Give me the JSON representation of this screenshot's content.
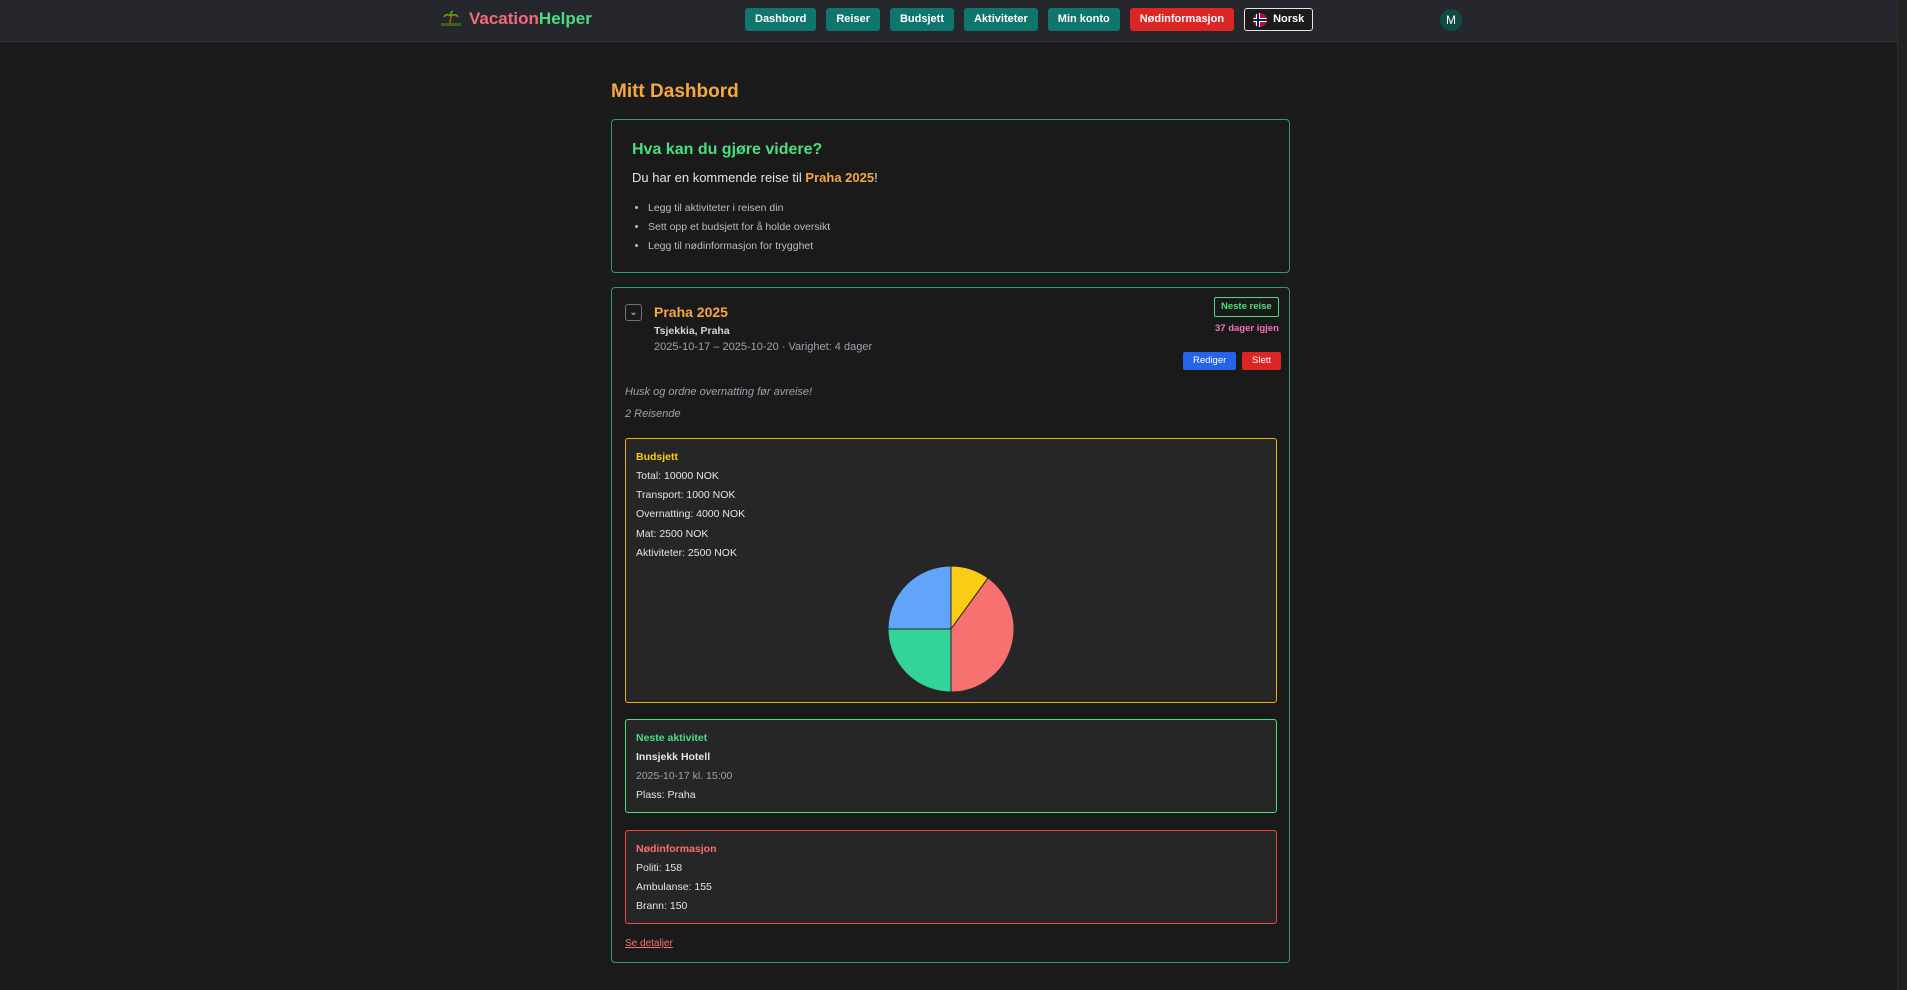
{
  "app": {
    "name_part1": "Vacation",
    "name_part2": "Helper"
  },
  "nav": {
    "items": [
      "Dashbord",
      "Reiser",
      "Budsjett",
      "Aktiviteter",
      "Min konto"
    ],
    "emergency": "Nødinformasjon",
    "language": "Norsk",
    "avatar_initial": "M"
  },
  "page": {
    "title": "Mitt Dashbord"
  },
  "next_steps": {
    "heading": "Hva kan du gjøre videre?",
    "lead_prefix": "Du har en kommende reise til ",
    "lead_trip": "Praha 2025",
    "lead_suffix": "!",
    "items": [
      "Legg til aktiviteter i reisen din",
      "Sett opp et budsjett for å holde oversikt",
      "Legg til nødinformasjon for trygghet"
    ]
  },
  "trip": {
    "title": "Praha 2025",
    "location": "Tsjekkia, Praha",
    "dates": "2025-10-17 – 2025-10-20 · Varighet: 4 dager",
    "badge": "Neste reise",
    "days_left": "37 dager igjen",
    "edit_label": "Rediger",
    "delete_label": "Slett",
    "note": "Husk og ordne overnatting før avreise!",
    "travelers": "2 Reisende",
    "details_link": "Se detaljer"
  },
  "budget": {
    "title": "Budsjett",
    "rows": [
      "Total: 10000 NOK",
      "Transport: 1000 NOK",
      "Overnatting: 4000 NOK",
      "Mat: 2500 NOK",
      "Aktiviteter: 2500 NOK"
    ],
    "chart_data": {
      "type": "pie",
      "categories": [
        "Transport",
        "Overnatting",
        "Mat",
        "Aktiviteter"
      ],
      "values": [
        1000,
        4000,
        2500,
        2500
      ],
      "colors": [
        "#facc15",
        "#f87171",
        "#34d399",
        "#60a5fa"
      ]
    }
  },
  "activity": {
    "title": "Neste aktivitet",
    "name": "Innsjekk Hotell",
    "datetime": "2025-10-17 kl. 15:00",
    "place": "Plass: Praha"
  },
  "emergency": {
    "title": "Nødinformasjon",
    "rows": [
      "Politi: 158",
      "Ambulanse: 155",
      "Brann: 150"
    ]
  }
}
